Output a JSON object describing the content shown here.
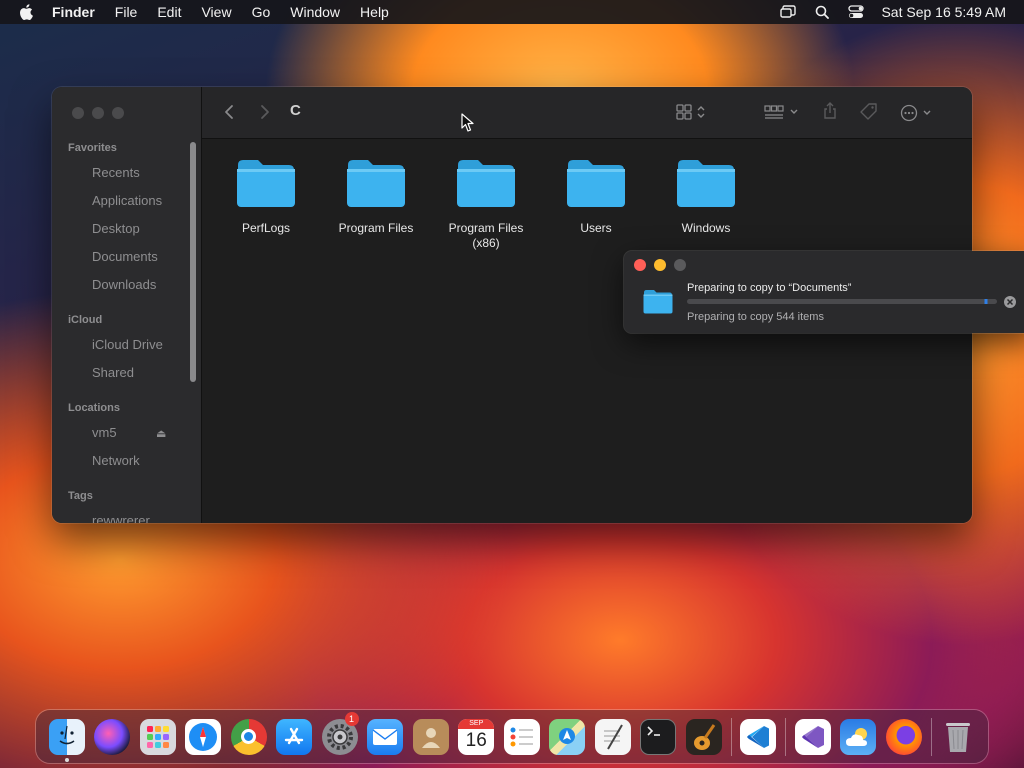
{
  "menubar": {
    "app_name": "Finder",
    "items": [
      "File",
      "Edit",
      "View",
      "Go",
      "Window",
      "Help"
    ],
    "clock": "Sat Sep 16  5:49 AM",
    "status_icons": [
      "screen-mirroring-icon",
      "search-icon",
      "control-center-icon"
    ]
  },
  "finder": {
    "title": "C",
    "sidebar": {
      "sections": [
        {
          "label": "Favorites",
          "items": [
            "Recents",
            "Applications",
            "Desktop",
            "Documents",
            "Downloads"
          ]
        },
        {
          "label": "iCloud",
          "items": [
            "iCloud Drive",
            "Shared"
          ]
        },
        {
          "label": "Locations",
          "items": [
            "vm5",
            "Network"
          ]
        },
        {
          "label": "Tags",
          "items": [
            "rewwrerer"
          ]
        }
      ]
    },
    "folders": [
      {
        "name": "PerfLogs"
      },
      {
        "name": "Program Files"
      },
      {
        "name": "Program Files (x86)"
      },
      {
        "name": "Users"
      },
      {
        "name": "Windows"
      }
    ]
  },
  "copy_dialog": {
    "title": "Preparing to copy to “Documents”",
    "subtitle": "Preparing to copy 544 items",
    "progress": 0.97
  },
  "dock": {
    "apps": [
      "Finder",
      "Siri",
      "Launchpad",
      "Safari",
      "Chrome",
      "App Store",
      "System Settings",
      "Mail",
      "Contacts",
      "Calendar",
      "Reminders",
      "Maps",
      "TextEdit",
      "Terminal",
      "GarageBand",
      "Visual Studio Code",
      "Visual Studio",
      "Weather",
      "Firefox",
      "Trash"
    ],
    "calendar_month": "SEP",
    "calendar_day": "16",
    "settings_badge": "1"
  },
  "colors": {
    "accent": "#2f7fe6",
    "folder": "#3db3ef",
    "close": "#ff5f57",
    "minimize": "#febc2e",
    "zoom_disabled": "#4a4a4c"
  }
}
